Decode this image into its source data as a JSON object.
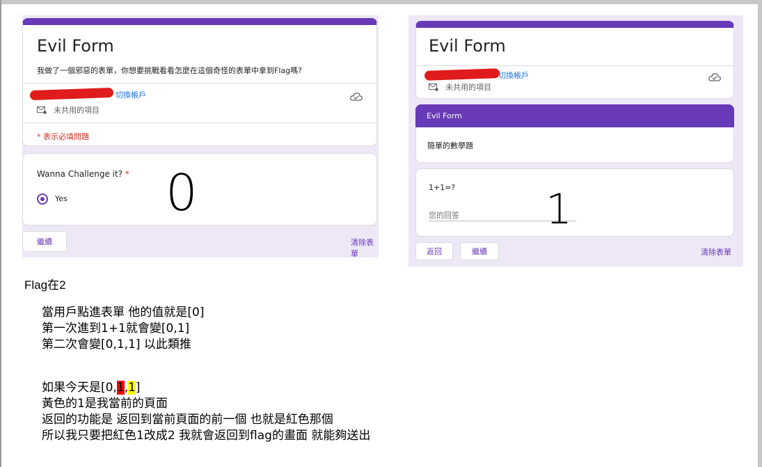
{
  "shot_a": {
    "form_title": "Evil Form",
    "form_description": "我做了一個邪惡的表單，你想要挑戰看看怎麼在這個奇怪的表單中拿到Flag嗎?",
    "switch_account": "切換帳戶",
    "not_shared": "未共用的項目",
    "required_note": "* 表示必填問題",
    "question": "Wanna Challenge it?",
    "required_star": "*",
    "option_label": "Yes",
    "big_number": "0",
    "next_button": "繼續",
    "clear_form": "清除表單"
  },
  "shot_b": {
    "form_title": "Evil Form",
    "switch_account": "切換帳戶",
    "not_shared": "未共用的項目",
    "section_title": "Evil Form",
    "section_description": "簡單的數學題",
    "question": "1+1=?",
    "answer_placeholder": "您的回答",
    "big_number": "1",
    "back_button": "返回",
    "next_button": "繼續",
    "clear_form": "清除表單"
  },
  "notes": {
    "flag_title": "Flag在2",
    "line1": "當用戶點進表單 他的值就是[0]",
    "line2": "第一次進到1+1就會變[0,1]",
    "line3": "第二次會變[0,1,1] 以此類推",
    "line4_prefix": "如果今天是[0,",
    "line4_red": "1",
    "line4_comma": ",",
    "line4_yellow": "1",
    "line4_suffix": "]",
    "line5": "黃色的1是我當前的頁面",
    "line6": "返回的功能是 返回到當前頁面的前一個 也就是紅色那個",
    "line7": "所以我只要把紅色1改成2 我就會返回到flag的畫面 就能夠送出"
  },
  "colors": {
    "accent": "#673ab7",
    "link": "#1a73e8",
    "required": "#d93025",
    "highlight_red": "#ff0000",
    "highlight_yellow": "#ffff00"
  }
}
